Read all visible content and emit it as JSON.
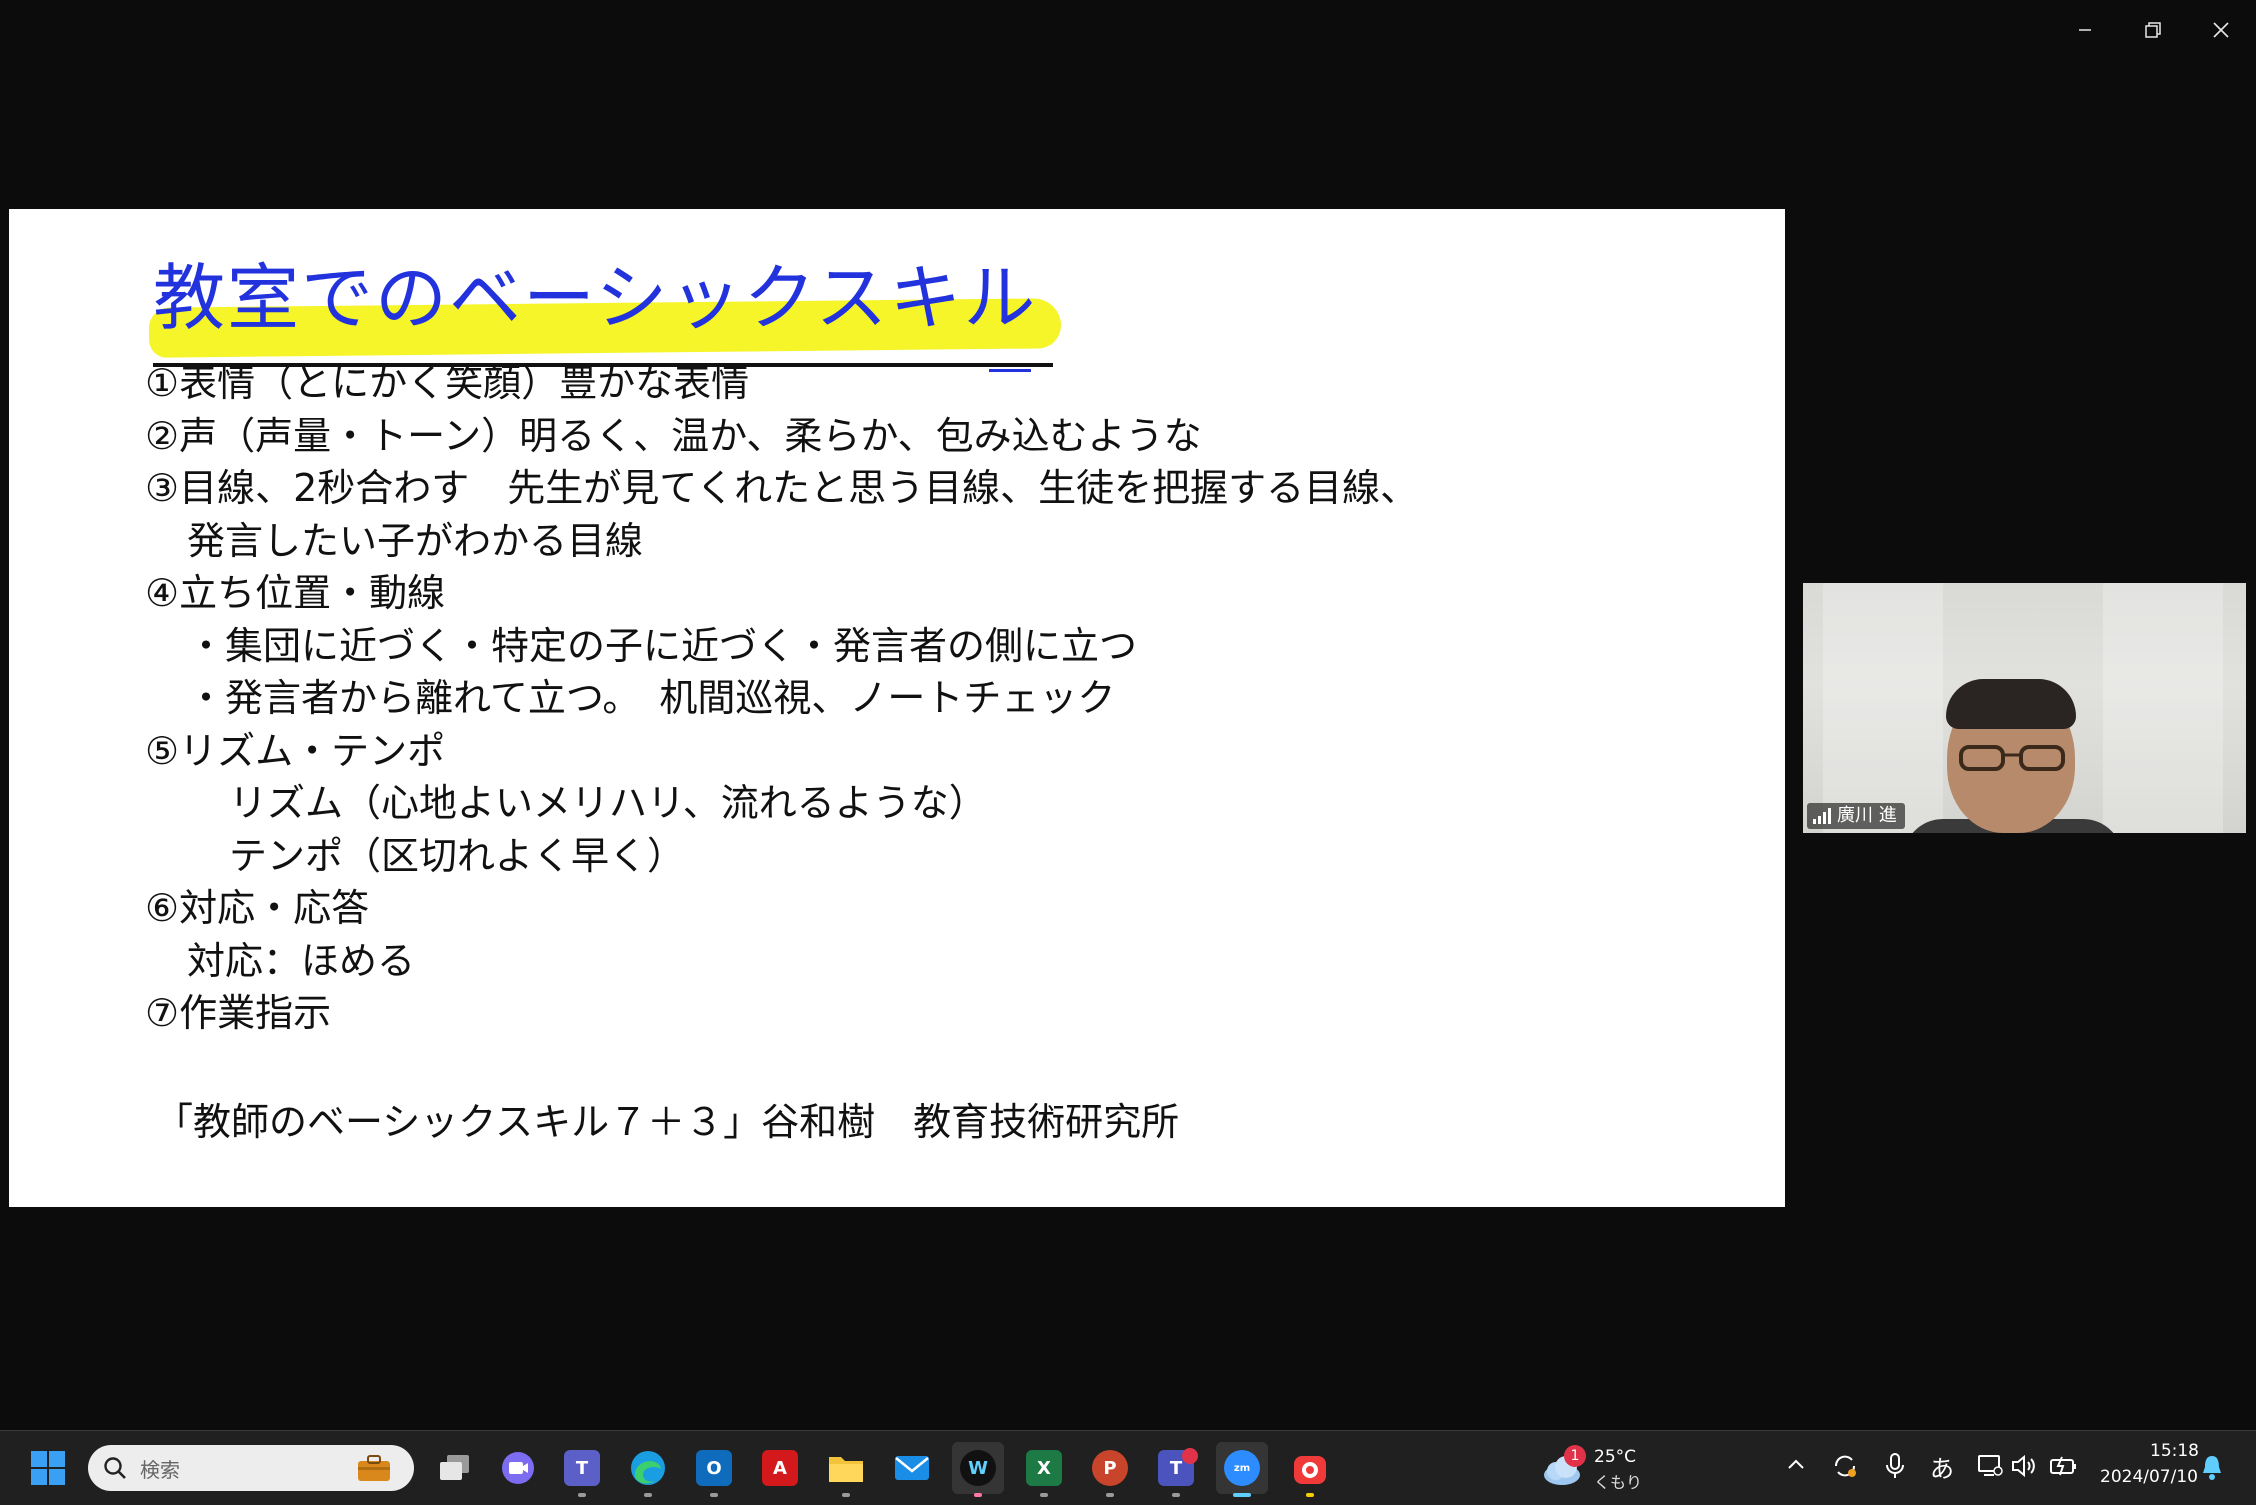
{
  "slide": {
    "title": "教室でのベーシックスキル",
    "lines": [
      "①表情（とにかく笑顔）豊かな表情",
      "②声（声量・トーン）明るく、温か、柔らか、包み込むような",
      "③目線、2秒合わす　先生が見てくれたと思う目線、生徒を把握する目線、",
      "発言したい子がわかる目線",
      "④立ち位置・動線",
      "・集団に近づく・特定の子に近づく・発言者の側に立つ",
      "・発言者から離れて立つ。　机間巡視、ノートチェック",
      "⑤リズム・テンポ",
      "リズム（心地よいメリハリ、流れるような）",
      "テンポ（区切れよく早く）",
      "⑥対応・応答",
      "対応：ほめる",
      "⑦作業指示"
    ],
    "citation": "「教師のベーシックスキル７＋３」谷和樹　教育技術研究所"
  },
  "participant": {
    "name": "廣川 進"
  },
  "taskbar": {
    "search_placeholder": "検索",
    "weather_temp": "25°C",
    "weather_desc": "くもり",
    "weather_badge": "1",
    "ime": "あ",
    "time": "15:18",
    "date": "2024/07/10"
  },
  "colors": {
    "title": "#2233dd",
    "highlight": "#f5f52a",
    "accent": "#60cdff"
  }
}
